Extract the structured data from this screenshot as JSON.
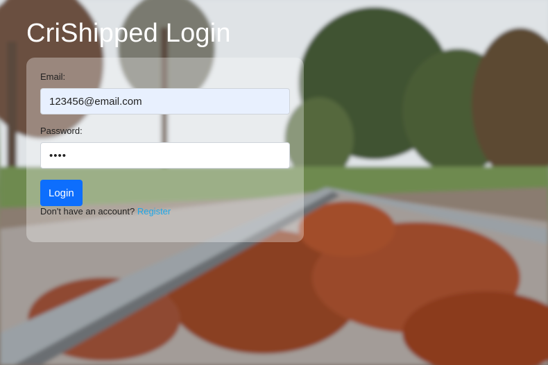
{
  "page": {
    "title": "CriShipped Login"
  },
  "form": {
    "email_label": "Email:",
    "email_value": "123456@email.com",
    "password_label": "Password:",
    "password_value": "abcd",
    "login_label": "Login",
    "signup_text": "Don't have an account?",
    "register_label": "Register"
  },
  "colors": {
    "primary": "#0d6efd",
    "link": "#1ea7e8",
    "autofill": "#e8f0fe"
  }
}
